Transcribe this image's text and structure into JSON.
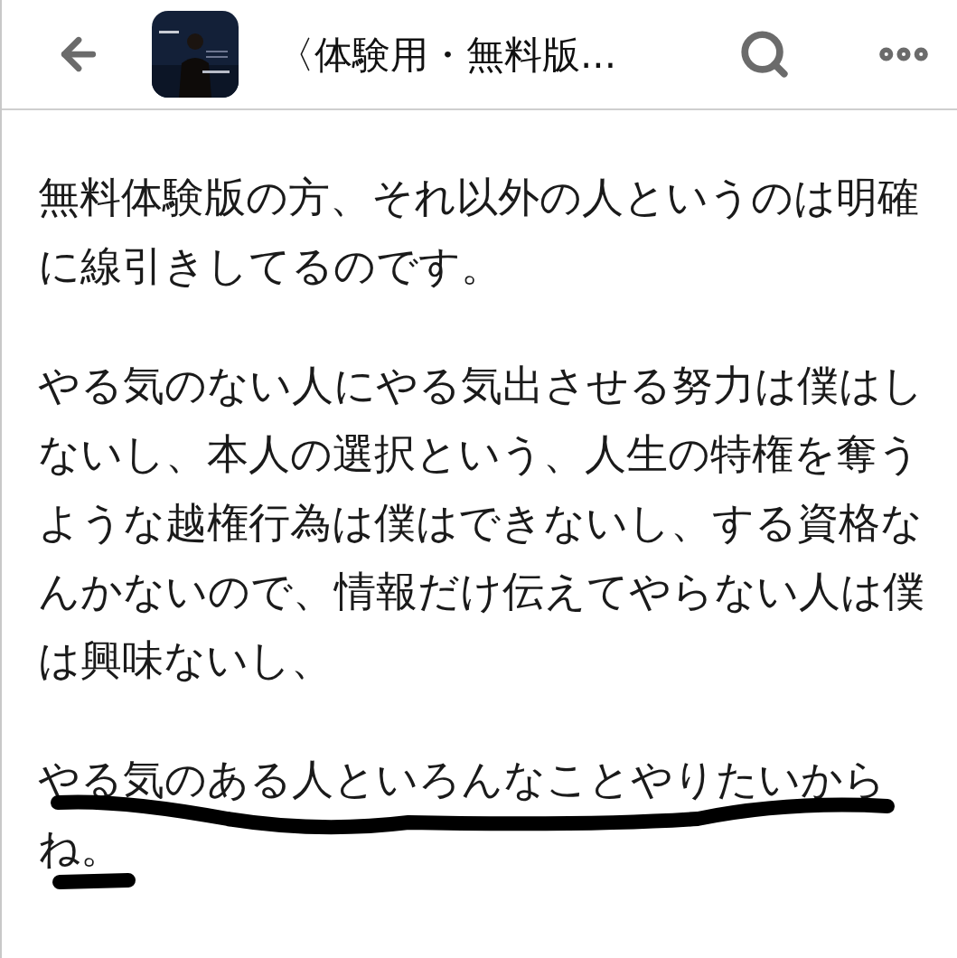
{
  "header": {
    "title": "〈体験用・無料版..."
  },
  "paragraphs": [
    {
      "text": "無料体験版の方、それ以外の人というのは明確に線引きしてるのです。",
      "marked": false
    },
    {
      "text": "やる気のない人にやる気出させる努力は僕はしないし、本人の選択という、人生の特権を奪うような越権行為は僕はできないし、する資格なんかないので、情報だけ伝えてやらない人は僕は興味ないし、",
      "marked": false
    },
    {
      "text": "やる気のある人といろんなことやりたいからね。",
      "marked": true
    }
  ]
}
